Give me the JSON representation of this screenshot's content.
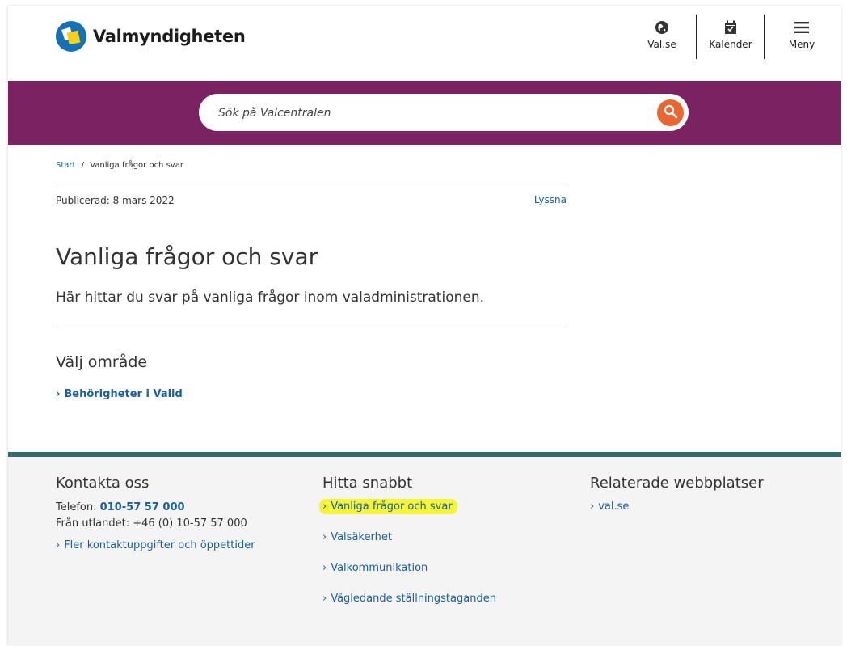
{
  "header": {
    "brand": "Valmyndigheten",
    "valse_label": "Val.se",
    "calendar_label": "Kalender",
    "menu_label": "Meny"
  },
  "search": {
    "placeholder": "Sök på Valcentralen"
  },
  "breadcrumb": {
    "home": "Start",
    "separator": "/",
    "current": "Vanliga frågor och svar"
  },
  "meta": {
    "published": "Publicerad: 8 mars 2022",
    "listen": "Lyssna"
  },
  "page": {
    "title": "Vanliga frågor och svar",
    "lead": "Här hittar du svar på vanliga frågor inom valadministrationen.",
    "area_heading": "Välj område",
    "area_links": [
      "Behörigheter i Valid"
    ]
  },
  "footer": {
    "contact": {
      "heading": "Kontakta oss",
      "phone_label": "Telefon:",
      "phone": "010-57 57 000",
      "abroad": "Från utlandet: +46 (0) 10-57 57 000",
      "more_link": "Fler kontaktuppgifter och öppettider"
    },
    "quick": {
      "heading": "Hitta snabbt",
      "links": [
        "Vanliga frågor och svar",
        "Valsäkerhet",
        "Valkommunikation",
        "Vägledande ställningstaganden"
      ]
    },
    "related": {
      "heading": "Relaterade webbplatser",
      "links": [
        "val.se"
      ]
    }
  },
  "colors": {
    "band": "#7b2262",
    "accent_link": "#1a5ea8",
    "search_button": "#e96630",
    "footer_bar": "#2f6e6a",
    "highlight": "#f5f536"
  },
  "icons": {
    "valse": "globe-icon",
    "calendar": "calendar-icon",
    "menu": "hamburger-icon",
    "search": "search-icon",
    "chevron": "chevron-right-icon"
  }
}
